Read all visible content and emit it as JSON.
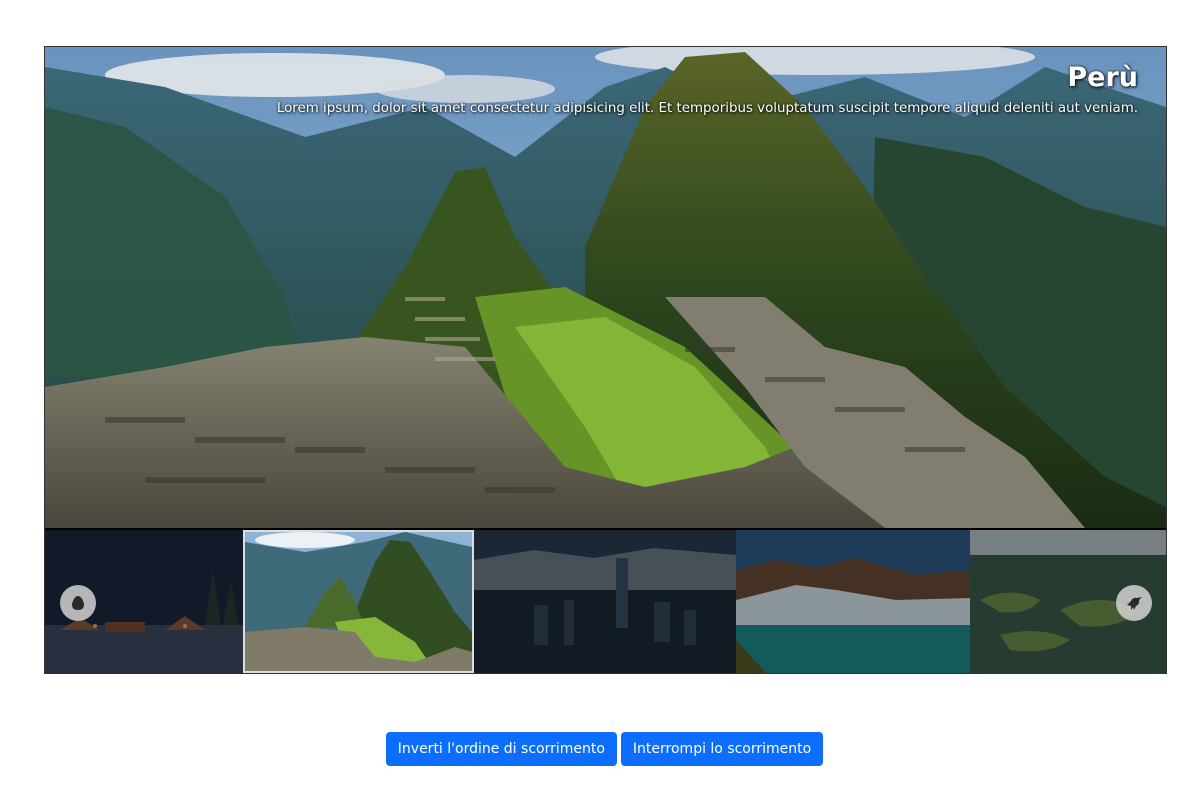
{
  "slide": {
    "title": "Perù",
    "text": "Lorem ipsum, dolor sit amet consectetur adipisicing elit. Et temporibus voluptatum suscipit tempore aliquid deleniti aut veniam."
  },
  "thumbnails": [
    {
      "name": "snowy-village",
      "active": false
    },
    {
      "name": "machu-picchu",
      "active": true
    },
    {
      "name": "city-skyline",
      "active": false
    },
    {
      "name": "glacier",
      "active": false
    },
    {
      "name": "lake-islands",
      "active": false
    }
  ],
  "nav": {
    "prev_icon": "egg-icon",
    "next_icon": "crow-icon"
  },
  "buttons": {
    "reverse_label": "Inverti l'ordine di scorrimento",
    "stop_label": "Interrompi lo scorrimento"
  },
  "colors": {
    "button_bg": "#0d6efd",
    "button_text": "#ffffff"
  }
}
